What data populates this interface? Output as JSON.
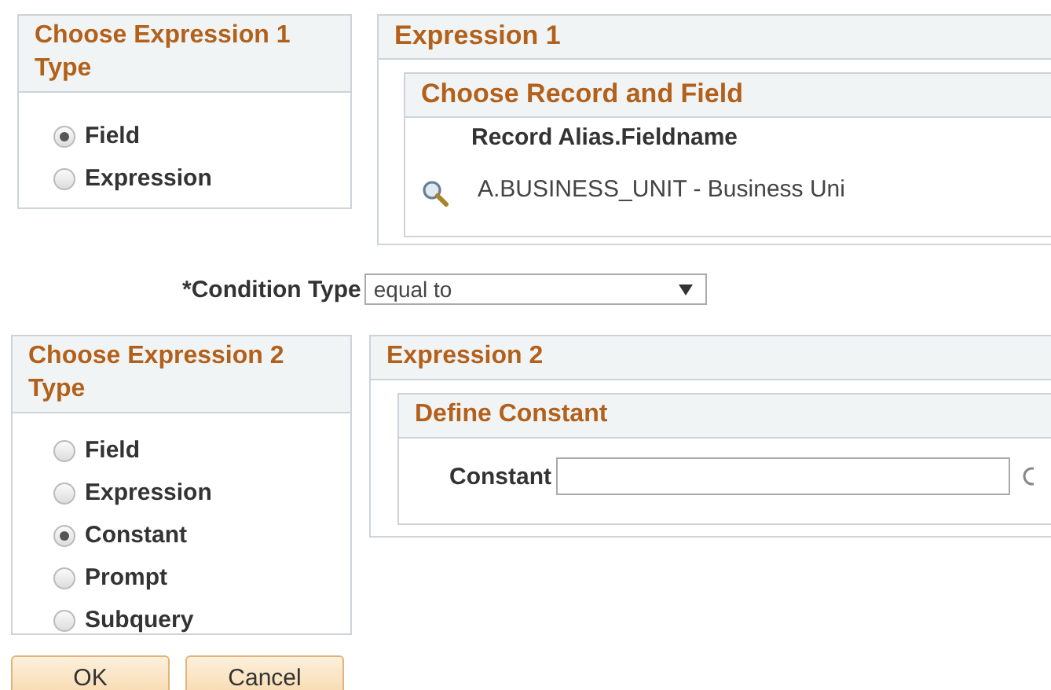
{
  "expression1_type": {
    "title": "Choose Expression 1 Type",
    "options": [
      {
        "label": "Field",
        "selected": true
      },
      {
        "label": "Expression",
        "selected": false
      }
    ]
  },
  "expression1": {
    "title": "Expression 1",
    "section": {
      "title": "Choose Record and Field",
      "column_header": "Record Alias.Fieldname",
      "value": "A.BUSINESS_UNIT - Business Uni"
    }
  },
  "condition_type": {
    "label": "*Condition Type",
    "value": "equal to"
  },
  "expression2_type": {
    "title": "Choose Expression 2 Type",
    "options": [
      {
        "label": "Field",
        "selected": false
      },
      {
        "label": "Expression",
        "selected": false
      },
      {
        "label": "Constant",
        "selected": true
      },
      {
        "label": "Prompt",
        "selected": false
      },
      {
        "label": "Subquery",
        "selected": false
      }
    ]
  },
  "expression2": {
    "title": "Expression 2",
    "section": {
      "title": "Define Constant",
      "field_label": "Constant"
    }
  },
  "buttons": [
    "OK",
    "Cancel"
  ]
}
